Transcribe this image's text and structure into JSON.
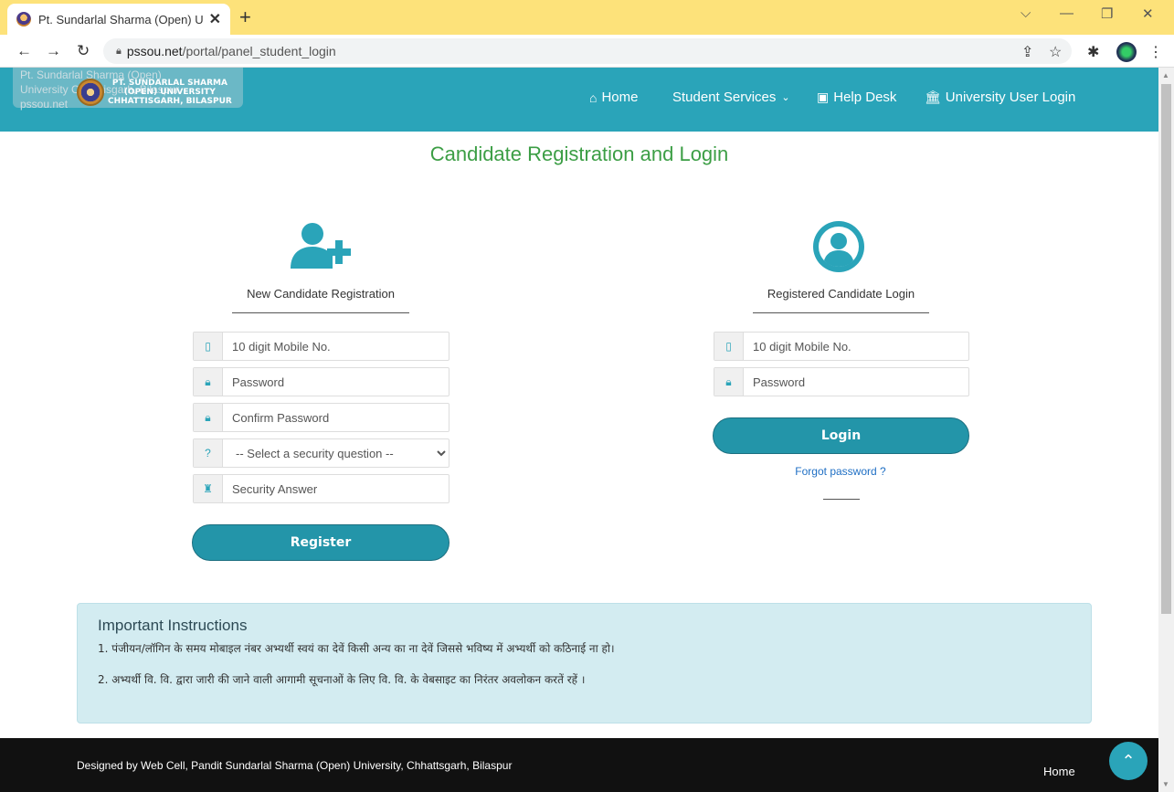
{
  "browser": {
    "tab_title": "Pt. Sundarlal Sharma (Open) Univ",
    "url_domain": "pssou.net",
    "url_path": "/portal/panel_student_login",
    "tooltip_line1": "Pt. Sundarlal Sharma (Open)",
    "tooltip_line2": "University Chhattisgarh, Bilaspur",
    "tooltip_line3": "pssou.net"
  },
  "site": {
    "logo_line1": "PT. SUNDARLAL SHARMA",
    "logo_line2": "(OPEN) UNIVERSITY",
    "logo_line3": "CHHATTISGARH, BILASPUR",
    "nav": {
      "home": "Home",
      "student_services": "Student Services",
      "help_desk": "Help Desk",
      "university_login": "University User Login"
    }
  },
  "page": {
    "title": "Candidate Registration and Login"
  },
  "registration": {
    "heading": "New Candidate Registration",
    "mobile_placeholder": "10 digit Mobile No.",
    "password_placeholder": "Password",
    "confirm_placeholder": "Confirm Password",
    "security_question_selected": "-- Select a security question --",
    "security_answer_placeholder": "Security Answer",
    "register_label": "Register"
  },
  "login": {
    "heading": "Registered Candidate Login",
    "mobile_placeholder": "10 digit Mobile No.",
    "password_placeholder": "Password",
    "login_label": "Login",
    "forgot_label": "Forgot password ?"
  },
  "instructions": {
    "heading": "Important Instructions",
    "item1": "1. पंजीयन/लॉगिन के समय मोबाइल नंबर अभ्यर्थी स्वयं का देवें किसी अन्य का ना देवें जिससे भविष्य में अभ्यर्थी को कठिनाई ना हो।",
    "item2": "2. अभ्यर्थी वि. वि. द्वारा जारी की जाने वाली आगामी सूचनाओं के लिए वि. वि. के वेबसाइट का निरंतर अवलोकन करतें रहें ।"
  },
  "footer": {
    "credit": "Designed by Web Cell, Pandit Sundarlal Sharma (Open) University, Chhattsgarh, Bilaspur",
    "home_link": "Home"
  },
  "colors": {
    "header_teal": "#2aa4b9",
    "title_green": "#3c9e45",
    "button": "#2395a9",
    "tabbar_yellow": "#fde27a",
    "instructions_bg": "#d3ecf1"
  }
}
